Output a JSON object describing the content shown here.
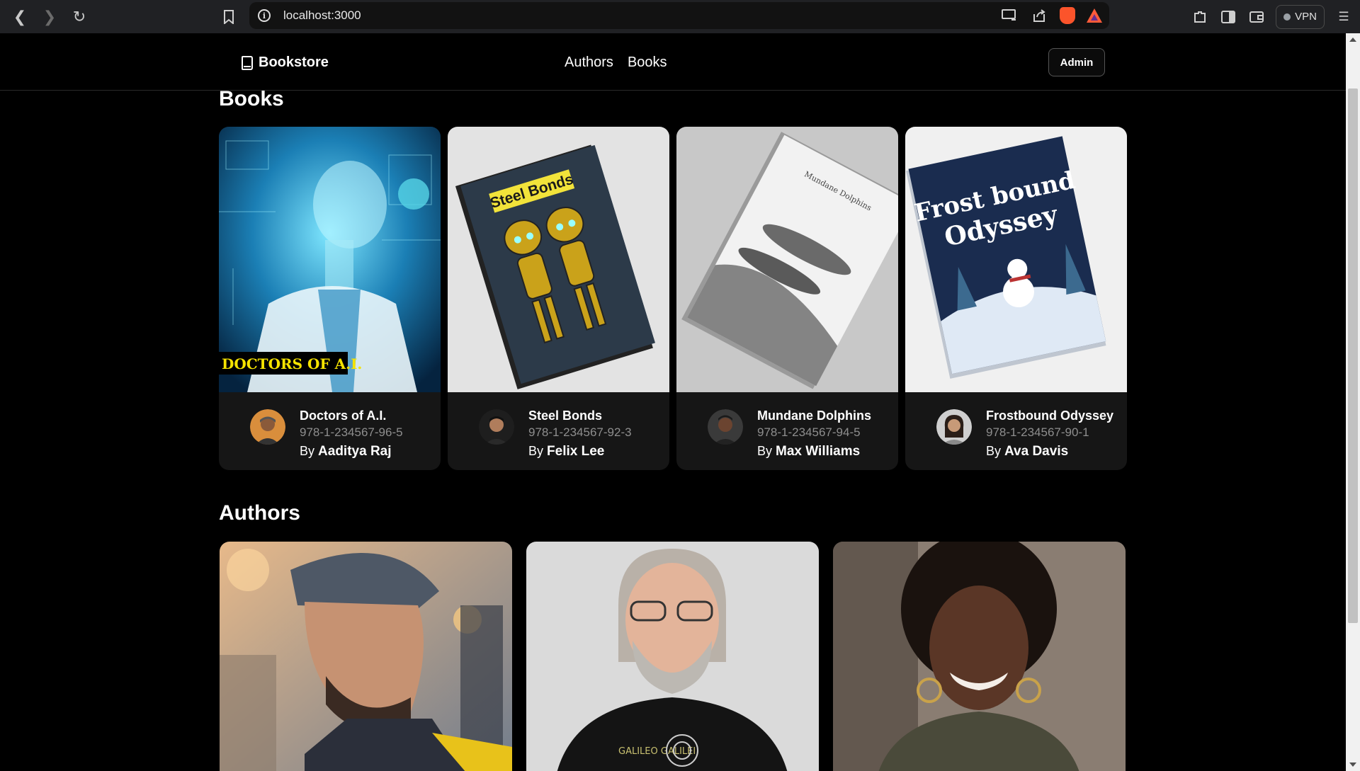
{
  "browser": {
    "url": "localhost:3000",
    "vpn_label": "VPN"
  },
  "site": {
    "logo_text": "Bookstore",
    "nav": [
      "Authors",
      "Books"
    ],
    "admin_label": "Admin"
  },
  "books_section": {
    "heading": "Books",
    "items": [
      {
        "title": "Doctors of A.I.",
        "isbn": "978-1-234567-96-5",
        "by": "By",
        "author": "Aaditya Raj",
        "cover_text": "DOCTORS OF A.I."
      },
      {
        "title": "Steel Bonds",
        "isbn": "978-1-234567-92-3",
        "by": "By",
        "author": "Felix Lee",
        "cover_text": "Steel Bonds"
      },
      {
        "title": "Mundane Dolphins",
        "isbn": "978-1-234567-94-5",
        "by": "By",
        "author": "Max Williams",
        "cover_text": "Mundane Dolphins"
      },
      {
        "title": "Frostbound Odyssey",
        "isbn": "978-1-234567-90-1",
        "by": "By",
        "author": "Ava Davis",
        "cover_text_line1": "Frost bound",
        "cover_text_line2": "Odyssey"
      }
    ]
  },
  "authors_section": {
    "heading": "Authors",
    "shirt_text": "GALILEO GALILEI"
  },
  "colors": {
    "background": "#000000",
    "card": "#161616",
    "muted_text": "#8e8e8e"
  }
}
